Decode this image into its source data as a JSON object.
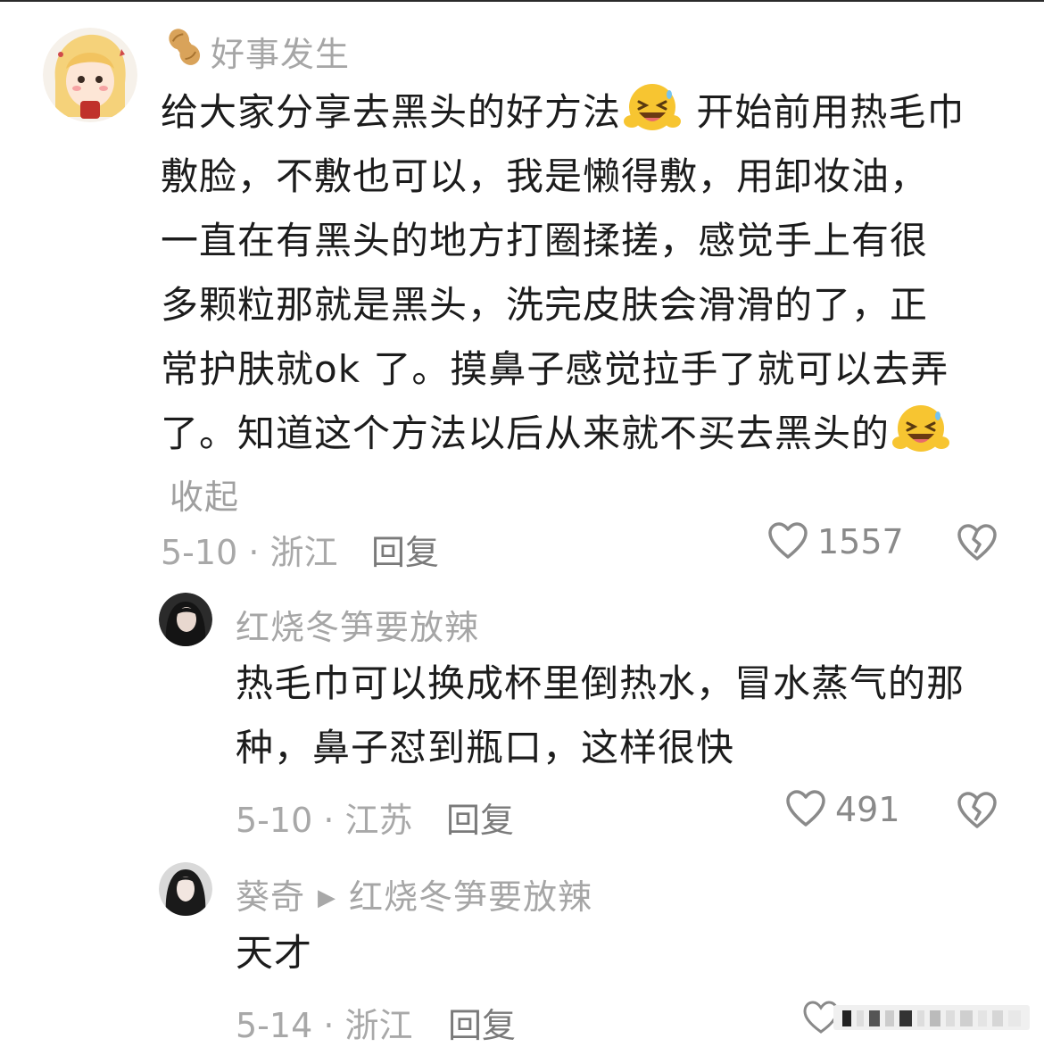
{
  "comments": [
    {
      "username": "好事发生",
      "content_lines": [
        "给大家分享去黑头的好方法",
        "开始前用热毛巾",
        "敷脸，不敷也可以，我是懒得敷，用卸妆油，",
        "一直在有黑头的地方打圈揉搓，感觉手上有很",
        "多颗粒那就是黑头，洗完皮肤会滑滑的了，正",
        "常护肤就ok 了。摸鼻子感觉拉手了就可以去弄",
        "了。知道这个方法以后从来就不买去黑头的"
      ],
      "collapse_label": "收起",
      "date_location": "5-10 · 浙江",
      "reply_label": "回复",
      "likes": "1557"
    },
    {
      "username": "红烧冬笋要放辣",
      "content_lines": [
        "热毛巾可以换成杯里倒热水，冒水蒸气的那",
        "种，鼻子怼到瓶口，这样很快"
      ],
      "date_location": "5-10 · 江苏",
      "reply_label": "回复",
      "likes": "491"
    },
    {
      "username": "葵奇",
      "reply_to": "红烧冬笋要放辣",
      "content_lines": [
        "天才"
      ],
      "date_location": "5-14 · 浙江",
      "reply_label": "回复"
    }
  ],
  "icons": {
    "badge": "peanut-badge-icon",
    "emoji": "grinning-squint-emoji-icon",
    "like": "heart-outline-icon",
    "dislike": "broken-heart-icon",
    "reply_arrow": "triangle-right-icon"
  },
  "colors": {
    "text": "#1c1c1c",
    "muted": "#a8a8a8",
    "action": "#7a7a7a",
    "emoji_face": "#f7c531"
  }
}
